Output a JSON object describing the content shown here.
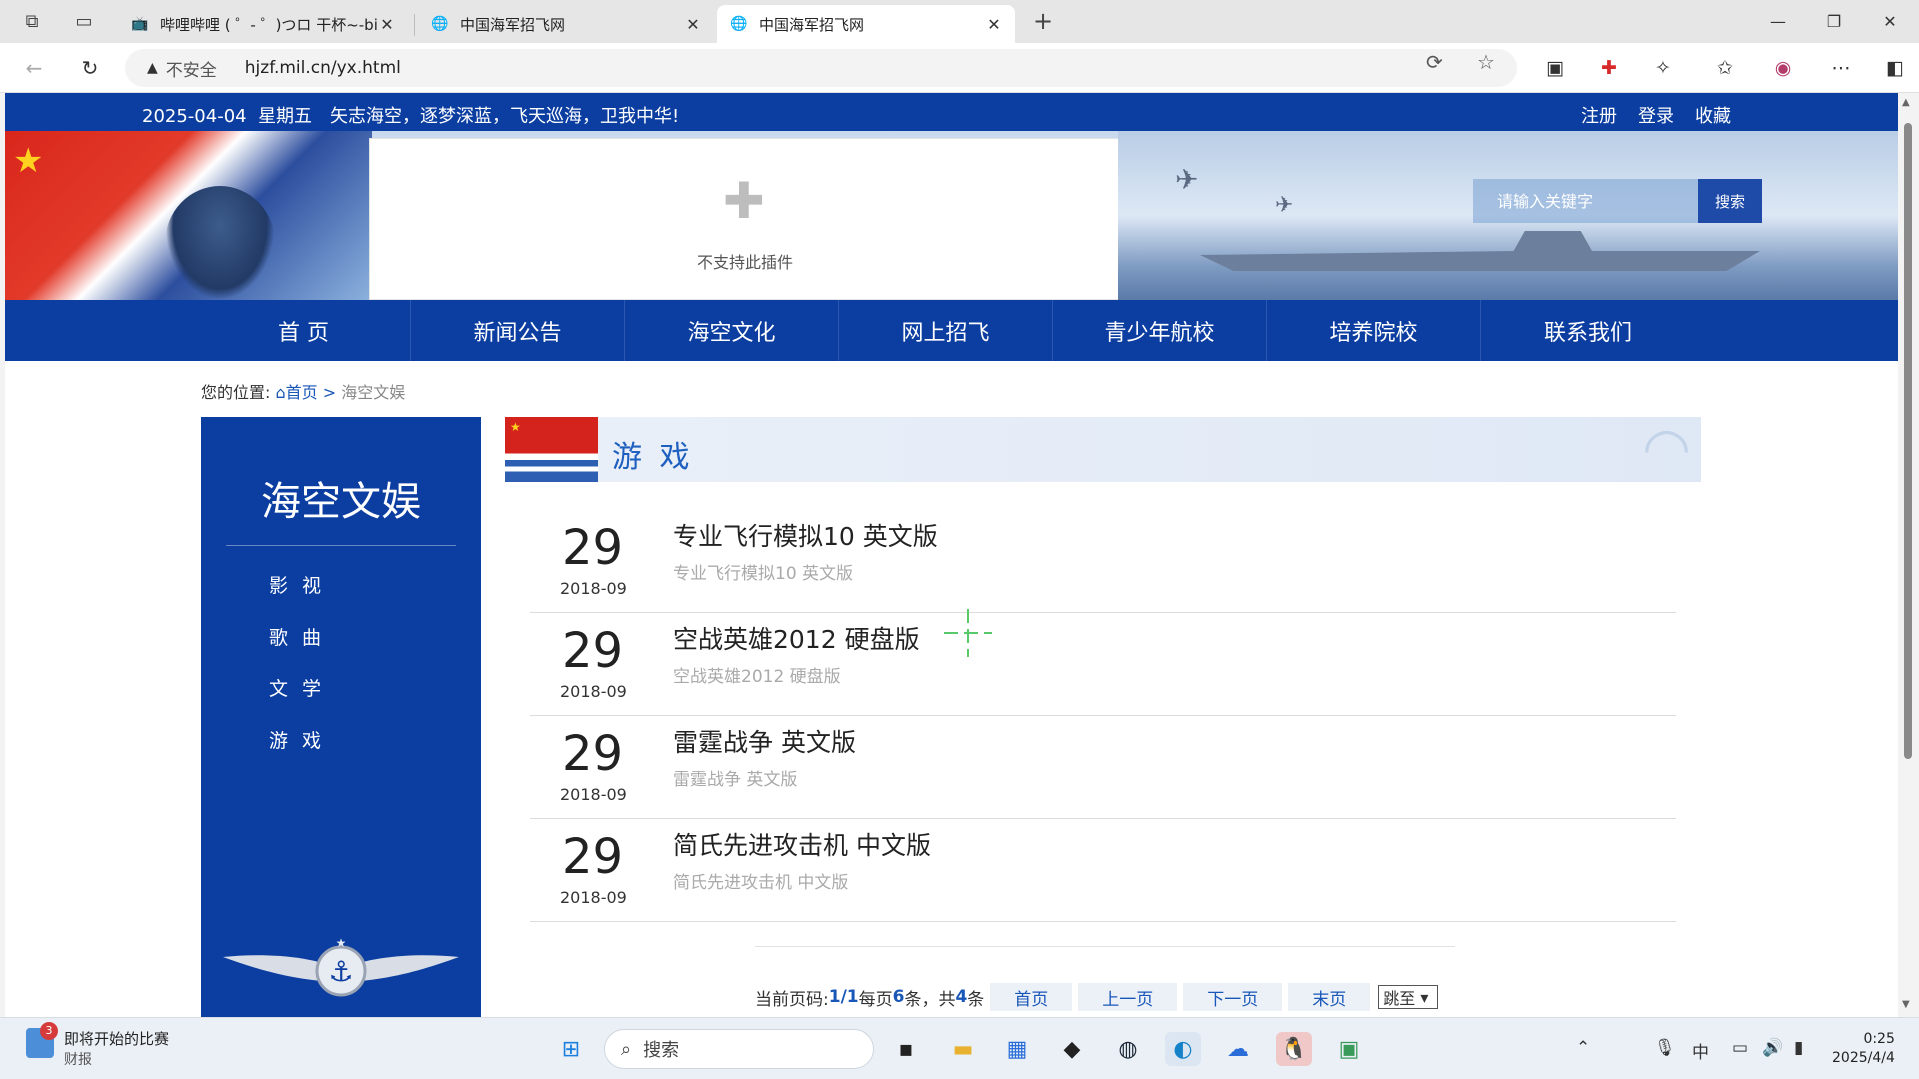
{
  "browser": {
    "tabs": [
      {
        "title": "哔哩哔哩 ( ゜- ゜)つロ 干杯~-bilibi"
      },
      {
        "title": "中国海军招飞网"
      },
      {
        "title": "中国海军招飞网"
      }
    ],
    "insecure_label": "不安全",
    "url": "hjzf.mil.cn/yx.html"
  },
  "site": {
    "date": "2025-04-04",
    "weekday": "星期五",
    "slogan": "矢志海空，逐梦深蓝，飞天巡海，卫我中华!",
    "top_links": [
      "注册",
      "登录",
      "收藏"
    ],
    "plugin_message": "不支持此插件",
    "search_placeholder": "请输入关键字",
    "search_button": "搜索",
    "nav": [
      "首  页",
      "新闻公告",
      "海空文化",
      "网上招飞",
      "青少年航校",
      "培养院校",
      "联系我们"
    ]
  },
  "breadcrumb": {
    "label": "您的位置:",
    "home": "首页",
    "sep": ">",
    "current": "海空文娱"
  },
  "sidebar": {
    "title": "海空文娱",
    "items": [
      "影 视",
      "歌 曲",
      "文 学",
      "游 戏"
    ]
  },
  "section": {
    "title": "游 戏"
  },
  "articles": [
    {
      "day": "29",
      "ym": "2018-09",
      "title": "专业飞行模拟10 英文版",
      "summary": "专业飞行模拟10 英文版"
    },
    {
      "day": "29",
      "ym": "2018-09",
      "title": "空战英雄2012 硬盘版",
      "summary": "空战英雄2012 硬盘版"
    },
    {
      "day": "29",
      "ym": "2018-09",
      "title": "雷霆战争 英文版",
      "summary": "雷霆战争 英文版"
    },
    {
      "day": "29",
      "ym": "2018-09",
      "title": "简氏先进攻击机 中文版",
      "summary": "简氏先进攻击机 中文版"
    }
  ],
  "pager": {
    "label": "当前页码:",
    "page": "1/1",
    "per_page_text": "每页",
    "per_page": "6",
    "unit": "条，共",
    "total": "4",
    "unit2": "条",
    "first": "首页",
    "prev": "上一页",
    "next": "下一页",
    "last": "末页",
    "jump": "跳至"
  },
  "taskbar": {
    "news_badge": "3",
    "news_title": "即将开始的比赛",
    "news_source": "财报",
    "search_label": "搜索",
    "ime": "中",
    "time": "0:25",
    "date": "2025/4/4"
  },
  "colors": {
    "brand_blue": "#0b3ea0",
    "link_blue": "#1856b8",
    "cursor_green": "#57c96b"
  }
}
